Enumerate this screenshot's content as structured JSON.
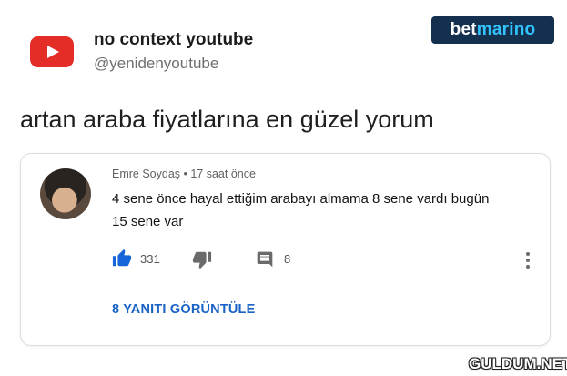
{
  "tweet": {
    "account_name": "no context youtube",
    "account_handle": "@yenidenyoutube",
    "text": "artan araba fiyatlarına en güzel yorum"
  },
  "brand": {
    "part1": "bet",
    "part2": "marino",
    "accent_color": "#33c4ff",
    "bg_color": "#14304f"
  },
  "comment": {
    "author": "Emre Soydaş",
    "time": "17 saat önce",
    "meta": "Emre Soydaş • 17 saat önce",
    "body": "4 sene önce hayal ettiğim arabayı almama 8 sene vardı bugün 15 sene var",
    "likes": "331",
    "replies_count": "8",
    "view_replies_label": "8 YANITI GÖRÜNTÜLE",
    "icons": {
      "like": "thumbs-up-icon",
      "dislike": "thumbs-down-icon",
      "reply": "comment-icon",
      "more": "more-vertical-icon"
    }
  },
  "watermark": "GULDUM.NET",
  "colors": {
    "youtube_red": "#e52d27",
    "link_blue": "#1a63c6",
    "like_blue": "#1565d8"
  }
}
